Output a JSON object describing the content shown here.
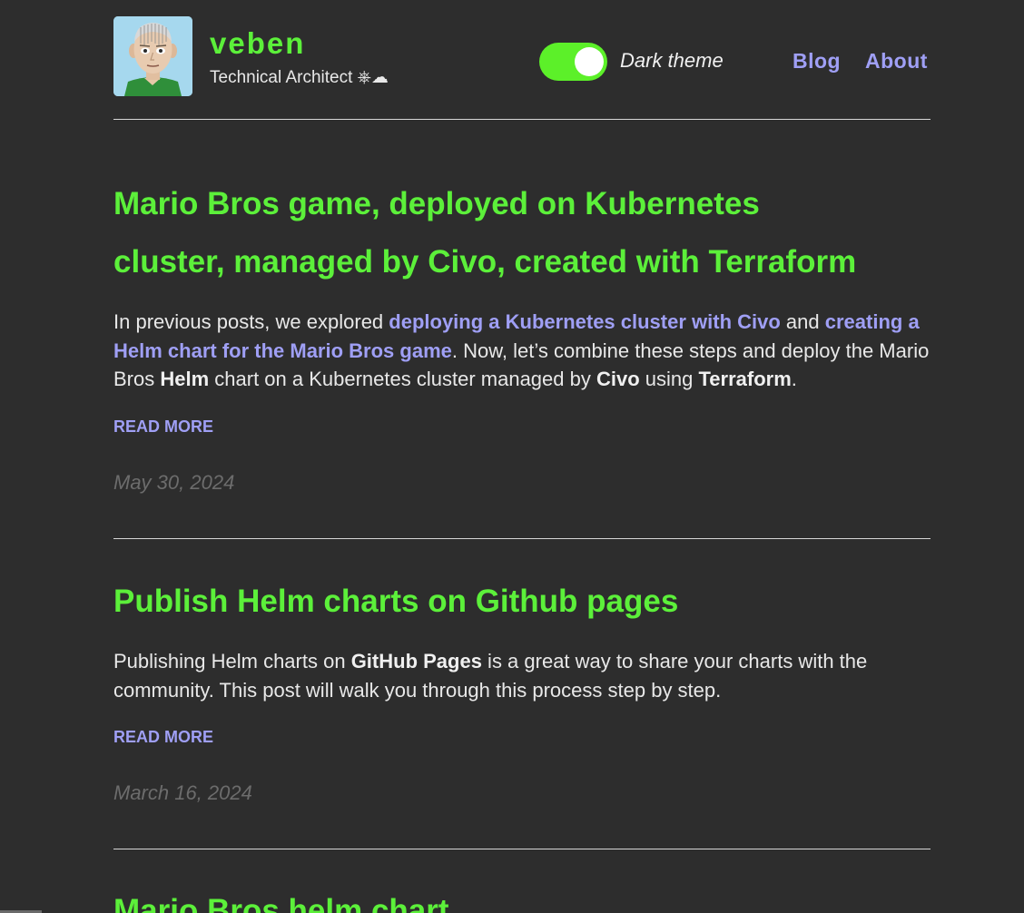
{
  "site": {
    "title": "veben",
    "subtitle": "Technical Architect ⎈☁"
  },
  "theme_toggle": {
    "label": "Dark theme",
    "on": true
  },
  "nav": {
    "blog": "Blog",
    "about": "About"
  },
  "posts": [
    {
      "title_line1": "Mario Bros game, deployed on Kubernetes",
      "title_line2": "cluster, managed by Civo, created with Terraform",
      "summary": {
        "p1": "In previous posts, we explored ",
        "link1": "deploying a Kubernetes cluster with Civo",
        "p2": " and ",
        "link2": "creating a Helm chart for the Mario Bros game",
        "p3": ". Now, let’s combine these steps and deploy the Mario Bros ",
        "b1": "Helm",
        "p4": " chart on a Kubernetes cluster managed by ",
        "b2": "Civo",
        "p5": " using ",
        "b3": "Terraform",
        "p6": "."
      },
      "read_more": "READ MORE",
      "date": "May 30, 2024"
    },
    {
      "title_line1": "Publish Helm charts on Github pages",
      "summary": {
        "p1": "Publishing Helm charts on ",
        "b1": "GitHub Pages",
        "p2": " is a great way to share your charts with the community. This post will walk you through this process step by step."
      },
      "read_more": "READ MORE",
      "date": "March 16, 2024"
    },
    {
      "title_line1": "Mario Bros helm chart"
    }
  ],
  "colors": {
    "background": "#2d2d2d",
    "accent_green": "#5cf03a",
    "link_purple": "#9f9ff5",
    "text": "#e8e8e8",
    "date_gray": "#6c6c6c"
  }
}
